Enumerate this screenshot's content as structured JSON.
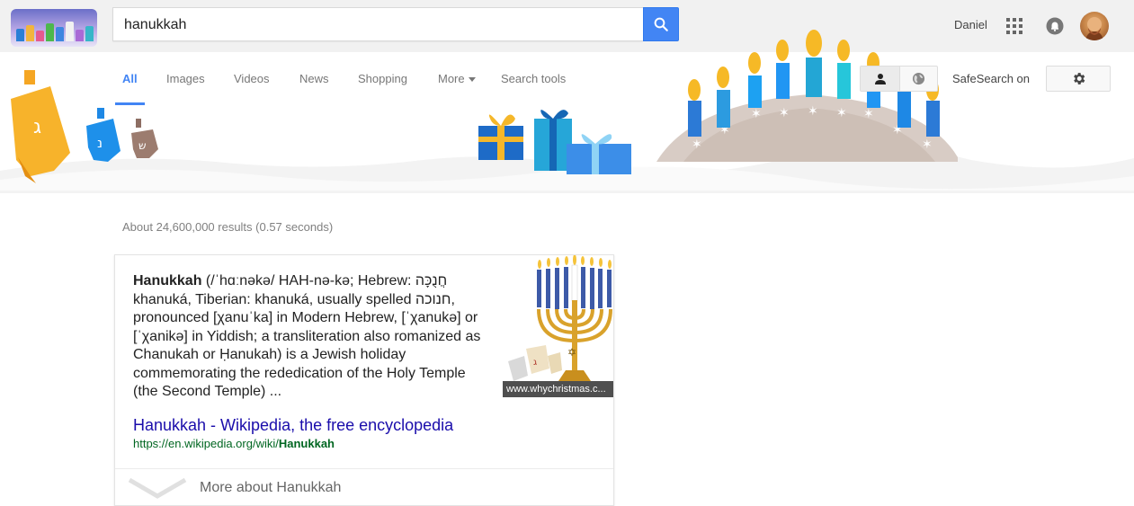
{
  "search": {
    "query": "hanukkah"
  },
  "account": {
    "user_name": "Daniel"
  },
  "tabs": [
    {
      "label": "All"
    },
    {
      "label": "Images"
    },
    {
      "label": "Videos"
    },
    {
      "label": "News"
    },
    {
      "label": "Shopping"
    },
    {
      "label": "More"
    },
    {
      "label": "Search tools"
    }
  ],
  "safesearch": {
    "label": "SafeSearch on"
  },
  "results": {
    "stats": "About 24,600,000 results (0.57 seconds)"
  },
  "knowledge_card": {
    "title": "Hanukkah",
    "description": " (/ˈhɑːnəkə/ HAH-nə-kə; Hebrew: חֲנֻכָּה‎ khanuká, Tiberian: khanuká, usually spelled חנוכה, pronounced [χanuˈka] in Modern Hebrew, [ˈχanukə] or [ˈχanikə] in Yiddish; a transliteration also romanized as Chanukah or Ḥanukah) is a Jewish holiday commemorating the rededication of the Holy Temple (the Second Temple) ...",
    "link_text": "Hanukkah - Wikipedia, the free encyclopedia",
    "url_prefix": "https://en.wikipedia.org/wiki/",
    "url_bold": "Hanukkah",
    "image_caption": "www.whychristmas.c...",
    "more_about": "More about Hanukkah"
  },
  "colors": {
    "accent_blue": "#4285f4",
    "link": "#1a0dab",
    "url_green": "#006621"
  }
}
